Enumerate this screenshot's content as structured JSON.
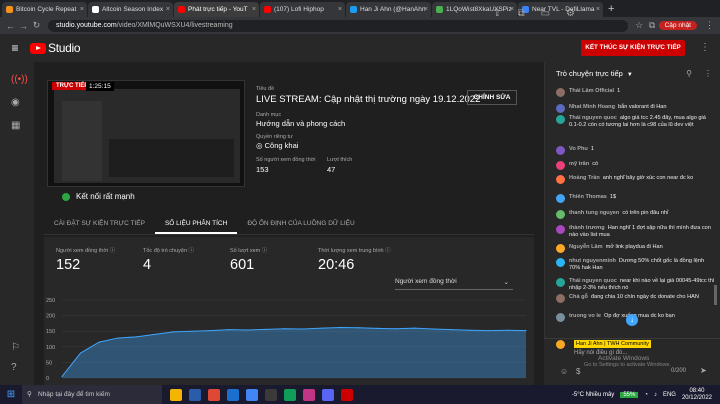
{
  "browser": {
    "tabs": [
      {
        "label": "Bitcoin Cycle Repeat",
        "color": "#f7931a",
        "active": false
      },
      {
        "label": "Altcoin Season Index",
        "color": "#ffffff",
        "active": false
      },
      {
        "label": "Phát trực tiếp - YouT",
        "color": "#ff0000",
        "active": true
      },
      {
        "label": "(107) Lofi Hiphop",
        "color": "#ff0000",
        "active": false
      },
      {
        "label": "Han Ji Ahn (@HanAhn",
        "color": "#1d9bf0",
        "active": false
      },
      {
        "label": "1LQoWist8XkaUXSPiz",
        "color": "#4caf50",
        "active": false
      },
      {
        "label": "Near TVL - DefiLlama",
        "color": "#3b82f6",
        "active": false
      }
    ],
    "url_domain": "studio.youtube.com",
    "url_path": "/video/XMlMQuWSXU4/livestreaming",
    "paused_label": "Cập nhật"
  },
  "header": {
    "studio_label": "Studio",
    "end_stream_label": "KẾT THÚC SỰ KIỆN TRỰC TIẾP"
  },
  "preview": {
    "live_badge": "TRỰC TIẾP",
    "elapsed": "1:25:15",
    "connection": "Kết nối rất mạnh"
  },
  "details": {
    "title_label": "Tiêu đề",
    "title": "LIVE STREAM: Cập nhật thị trường ngày 19.12.2022",
    "edit_label": "CHỈNH SỬA",
    "category_label": "Danh mục",
    "category": "Hướng dẫn và phong cách",
    "privacy_label": "Quyền riêng tư",
    "privacy": "Công khai",
    "viewers_label": "Số người xem đồng thời",
    "viewers": "153",
    "likes_label": "Lượt thích",
    "likes": "47"
  },
  "tabs": [
    "CÀI ĐẶT SỰ KIỆN TRỰC TIẾP",
    "SỐ LIỆU PHÂN TÍCH",
    "ĐỘ ỔN ĐỊNH CỦA LUỒNG DỮ LIỆU"
  ],
  "stats": [
    {
      "label": "Người xem đồng thời",
      "value": "152"
    },
    {
      "label": "Tốc độ trò chuyện",
      "value": "4"
    },
    {
      "label": "Số lượt xem",
      "value": "601"
    },
    {
      "label": "Thời lượng xem trung bình",
      "value": "20:46"
    }
  ],
  "metric_select": "Người xem đồng thời",
  "chart_data": {
    "type": "area",
    "y_ticks": [
      "250",
      "200",
      "150",
      "100",
      "50",
      "0"
    ],
    "ylim": [
      0,
      250
    ],
    "x": [
      0,
      1,
      2,
      3,
      4,
      5,
      6,
      7,
      8,
      9,
      10,
      11,
      12,
      13,
      14,
      15,
      16,
      17,
      18,
      19,
      20,
      21,
      22,
      23,
      24,
      25
    ],
    "values": [
      5,
      80,
      115,
      128,
      132,
      140,
      148,
      150,
      152,
      155,
      154,
      156,
      158,
      157,
      160,
      162,
      161,
      159,
      158,
      160,
      157,
      155,
      153,
      152,
      153,
      152
    ]
  },
  "chat": {
    "title": "Trò chuyện trực tiếp",
    "messages": [
      {
        "name": "Thái Lâm Official",
        "text": "1",
        "color": "#8d6e63"
      },
      {
        "name": "Nhat Minh Hoang",
        "text": "bắn valorant đi Han",
        "color": "#5c6bc0"
      },
      {
        "name": "Thái nguyen quoc",
        "text": "algo giá tcc 2.45 đây, mua algo giá 0.1-0.2 còn có tương lai hơn là c98 của lũ dev việt",
        "color": "#26a69a"
      },
      {
        "name": "Vo Phu",
        "text": "1",
        "color": "#7e57c2"
      },
      {
        "name": "mỹ trân",
        "text": "có",
        "color": "#ec407a"
      },
      {
        "name": "Hoàng Trần",
        "text": "anh nghĩ bây giờ xúc con near đc ko",
        "color": "#ff7043"
      },
      {
        "name": "Thiên Thomas",
        "text": "1$",
        "color": "#42a5f5"
      },
      {
        "name": "thanh tung nguyen",
        "text": "có trên pin đâu nhỉ",
        "color": "#66bb6a"
      },
      {
        "name": "thành trương",
        "text": "Han nghĩ 1 đợt sập nữa thì mình đưa con nào vào list mua",
        "color": "#ab47bc"
      },
      {
        "name": "Nguyễn Lâm",
        "text": "mở link playdua đi Han",
        "color": "#ffa726"
      },
      {
        "name": "nhut nguyenminh",
        "text": "Dương 50% chốt gốc là đồng lệnh 70% hak Han",
        "color": "#29b6f6"
      },
      {
        "name": "Thái nguyen quoc",
        "text": "near khi nào về lại giá 00045-49tcc thì nhập 2-3% nếu thích nó",
        "color": "#26a69a"
      },
      {
        "name": "Chả gỗ",
        "text": "đang chia 10 chín ngày dc donate cho HAN",
        "color": "#8d6e63"
      },
      {
        "name": "truong vo le",
        "text": "Op đợ xuống mua dc ko bạn",
        "color": "#78909c"
      }
    ],
    "owner_badge": "Han Ji Ahn | TWH Community",
    "placeholder": "Hãy nói điều gì đó...",
    "counter": "0/200"
  },
  "activation": {
    "line1": "Activate Windows",
    "line2": "Go to Settings to activate Windows."
  },
  "taskbar": {
    "search": "Nhập tại đây để tìm kiếm",
    "weather": "-5°C Nhiều mây",
    "battery": "55%",
    "lang": "ENG",
    "time": "08:40",
    "date": "20/12/2022"
  }
}
